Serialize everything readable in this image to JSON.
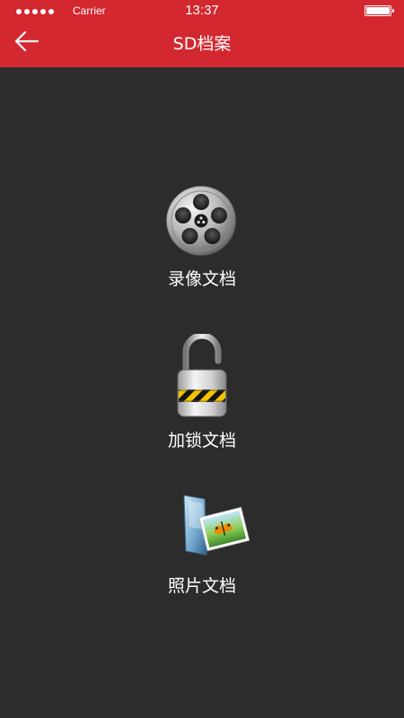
{
  "status_bar": {
    "carrier": "Carrier",
    "time": "13:37"
  },
  "header": {
    "title": "SD档案",
    "back_icon": "arrow-left-icon"
  },
  "colors": {
    "header_bg": "#d3282f",
    "page_bg": "#2c2c2c",
    "text": "#ffffff"
  },
  "items": [
    {
      "label": "录像文档",
      "icon": "film-reel-icon"
    },
    {
      "label": "加锁文档",
      "icon": "padlock-icon"
    },
    {
      "label": "照片文档",
      "icon": "photo-folder-icon"
    }
  ]
}
